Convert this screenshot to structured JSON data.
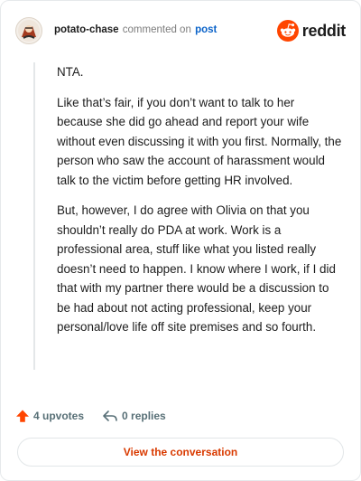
{
  "header": {
    "username": "potato-chase",
    "action_text": "commented on",
    "post_link": "post",
    "brand": "reddit",
    "icons": {
      "avatar": "user-avatar",
      "logo": "reddit-snoo-logo"
    },
    "colors": {
      "brand_orange": "#ff4500",
      "link_blue": "#0b63c9"
    }
  },
  "comment": {
    "paragraphs": [
      "NTA.",
      "Like that’s fair, if you don’t want to talk to her because she did go ahead and report your wife without even discussing it with you first. Normally, the person who saw the account of harassment would talk to the victim before getting HR involved.",
      "But, however, I do agree with Olivia on that you shouldn’t really do PDA at work. Work is a professional area, stuff like what you listed really doesn’t need to happen. I know where I work, if I did that with my partner there would be a discussion to be had about not acting professional, keep your personal/love life off site premises and so fourth."
    ]
  },
  "actions": {
    "upvotes_label": "4 upvotes",
    "replies_label": "0 replies",
    "icons": {
      "upvote": "upvote-arrow-icon",
      "reply": "reply-arrow-icon"
    }
  },
  "cta": {
    "label": "View the conversation",
    "color": "#d93a00"
  }
}
